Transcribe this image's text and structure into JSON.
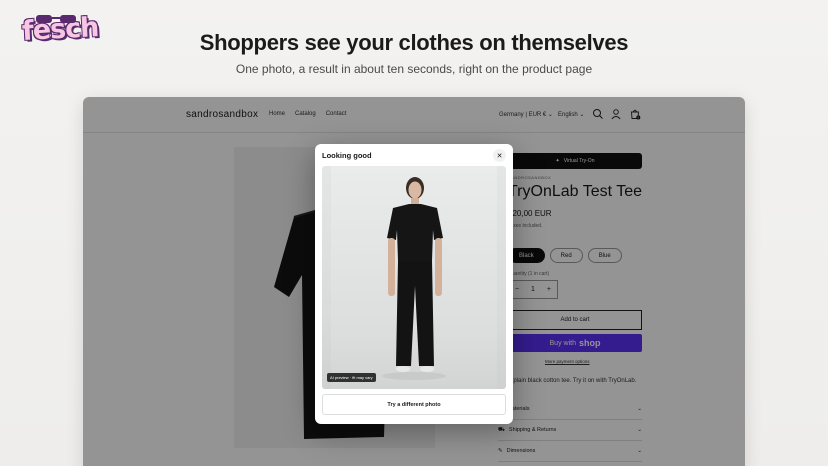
{
  "brand": {
    "logo_text": "fesch"
  },
  "hero": {
    "headline": "Shoppers see your clothes on themselves",
    "subline": "One photo, a result in about ten seconds, right on the product page"
  },
  "store": {
    "shop_name": "sandrosandbox",
    "nav": [
      "Home",
      "Catalog",
      "Contact"
    ],
    "locale": "Germany | EUR €",
    "language": "English",
    "cart_count": "0",
    "tryon_button": "Virtual Try-On",
    "vendor": "SANDROSANDBOX",
    "title": "TryOnLab Test Tee",
    "price": "€20,00 EUR",
    "tax_note": "Taxes included.",
    "colors": [
      "Black",
      "Red",
      "Blue"
    ],
    "quantity_label": "Quantity (1 in cart)",
    "quantity": "1",
    "add_to_cart": "Add to cart",
    "buy_with": "Buy with",
    "buy_with_brand": "shop",
    "more_payment": "More payment options",
    "description": "A plain black cotton tee. Try it on with TryOnLab.",
    "accordions": [
      "Materials",
      "Shipping & Returns",
      "Dimensions"
    ]
  },
  "modal": {
    "title": "Looking good",
    "badge": "AI preview · fit may vary",
    "action": "Try a different photo"
  },
  "colors": {
    "shop_purple": "#5a31f4",
    "dark": "#111111"
  }
}
